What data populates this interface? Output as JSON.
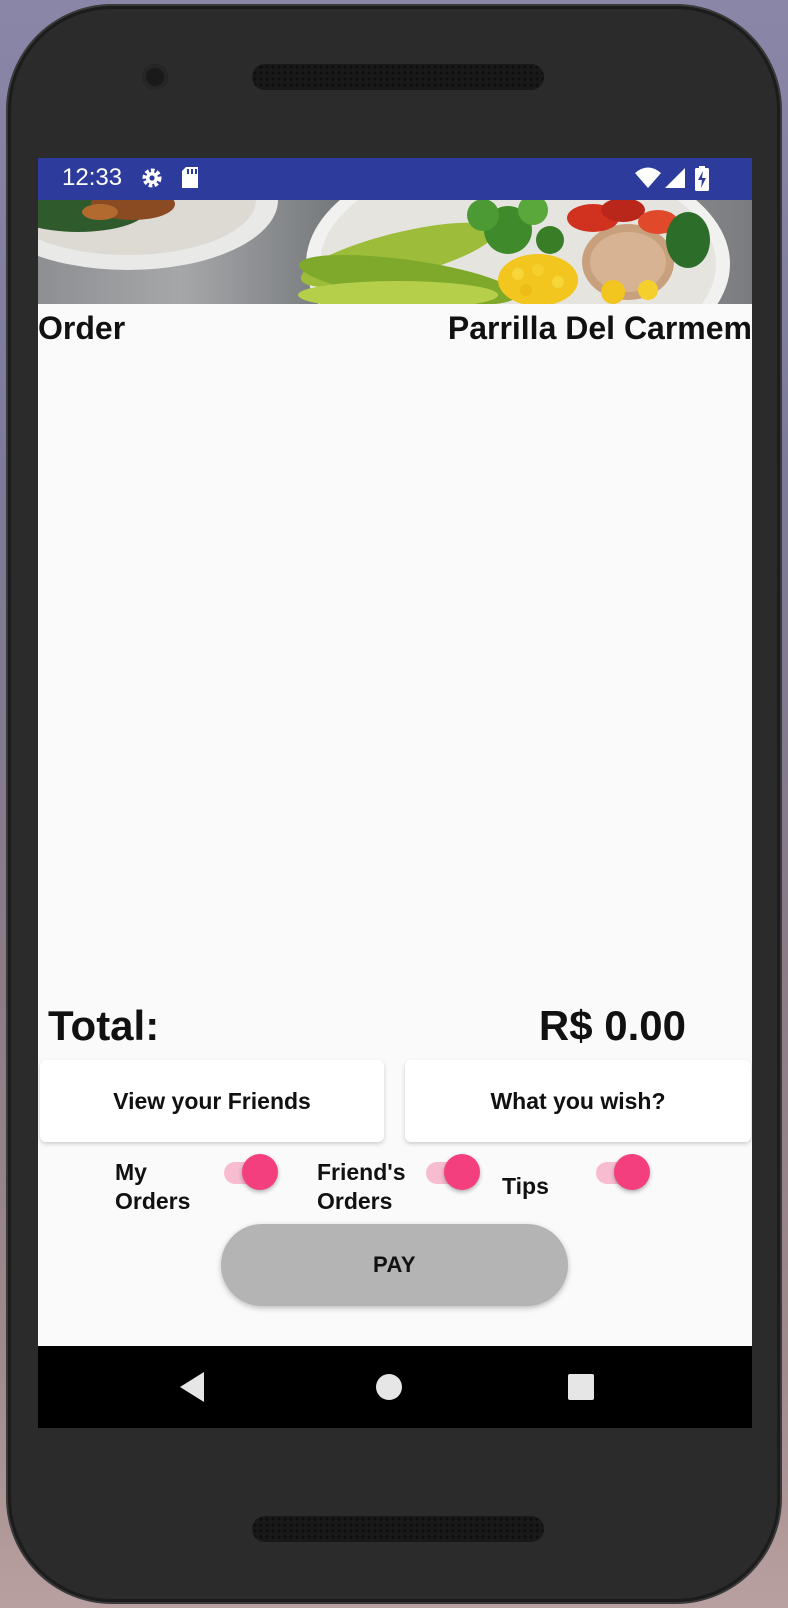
{
  "status_bar": {
    "time": "12:33",
    "icons": [
      "gear-icon",
      "sd-card-icon",
      "wifi-icon",
      "signal-icon",
      "battery-charging-icon"
    ],
    "background": "#2d3c9c"
  },
  "banner": {
    "image": "food-bowl-photo"
  },
  "header": {
    "title": "Order",
    "restaurant": "Parrilla Del Carmem"
  },
  "totals": {
    "label": "Total:",
    "value": "R$ 0.00"
  },
  "actions": {
    "view_friends": "View your Friends",
    "wish": "What you wish?"
  },
  "toggles": [
    {
      "label_line1": "My",
      "label_line2": "Orders",
      "on": true
    },
    {
      "label_line1": "Friend's",
      "label_line2": "Orders",
      "on": true
    },
    {
      "label_line1": "Tips",
      "label_line2": "",
      "on": true
    }
  ],
  "pay": {
    "label": "PAY"
  },
  "nav_bar": {
    "items": [
      "back-icon",
      "home-icon",
      "recents-icon"
    ]
  },
  "colors": {
    "accent": "#f43f7f",
    "switch_track": "#f8bcd0",
    "pay_button": "#b4b4b4"
  }
}
